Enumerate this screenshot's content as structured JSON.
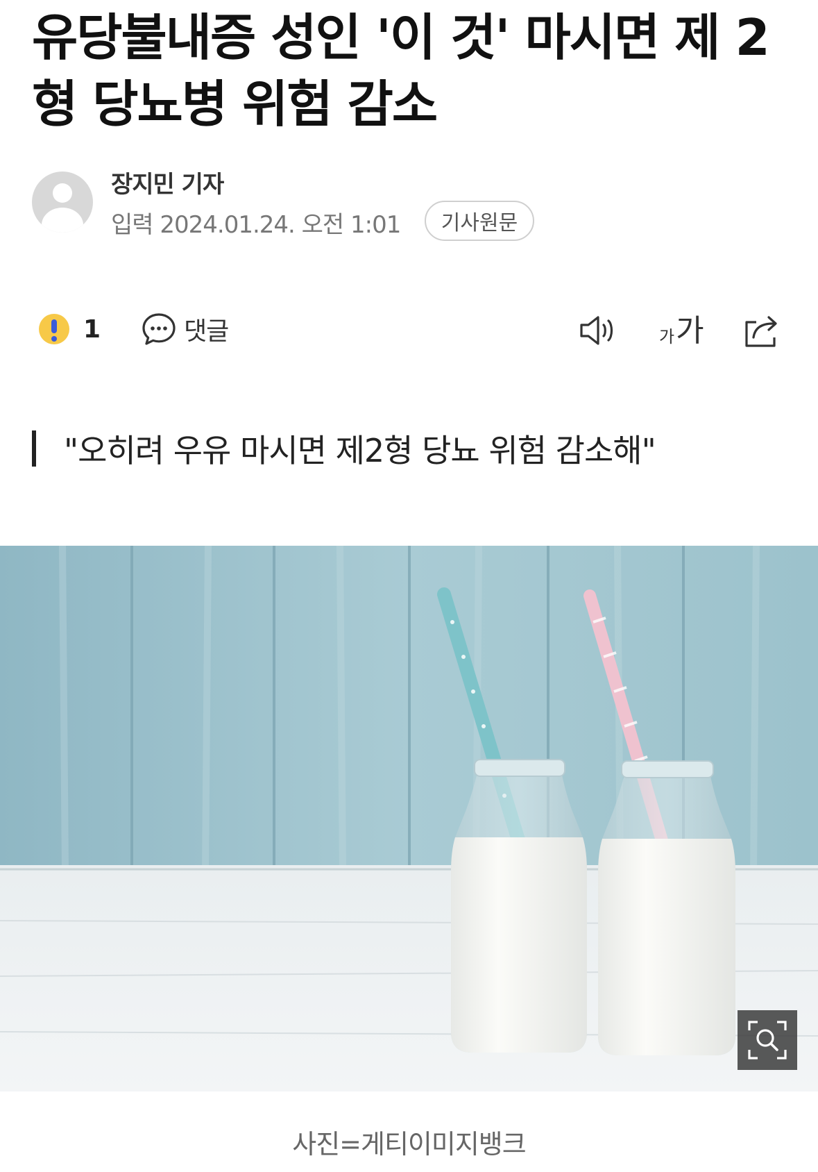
{
  "article": {
    "headline": "유당불내증 성인 '이 것' 마시면 제 2형 당뇨병 위험 감소",
    "author": "장지민 기자",
    "dateline": "입력 2024.01.24. 오전 1:01",
    "source_button": "기사원문"
  },
  "toolbar": {
    "reaction_icon": "exclamation-emoji-icon",
    "reaction_count": "1",
    "comment_label": "댓글",
    "tts_icon": "speaker-icon",
    "font_small": "가",
    "font_big": "가",
    "share_icon": "share-icon"
  },
  "subheading": "\"오히려 우유 마시면 제2형 당뇨 위험 감소해\"",
  "photo": {
    "caption": "사진=게티이미지뱅크",
    "zoom_icon": "zoom-icon"
  },
  "colors": {
    "background": "#ffffff",
    "text": "#111111",
    "muted": "#777777",
    "accent_emoji": "#f7c948"
  }
}
